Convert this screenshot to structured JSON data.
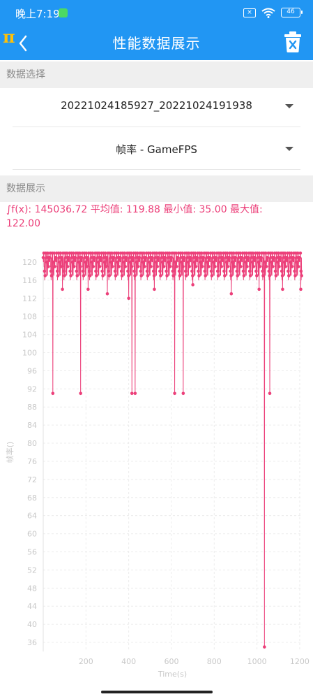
{
  "status_bar": {
    "time": "晚上7:19",
    "battery": "46"
  },
  "app_bar": {
    "title": "性能数据展示",
    "logo_text": "π"
  },
  "data_select": {
    "section_label": "数据选择",
    "file_value": "20221024185927_20221024191938",
    "metric_value": "帧率 - GameFPS"
  },
  "data_display": {
    "section_label": "数据展示",
    "summary_line1": "∫f(x): 145036.72 平均值: 119.88 最小值: 35.00 最大值:",
    "summary_line2": "122.00"
  },
  "colors": {
    "primary": "#2196f3",
    "series": "#ec407a",
    "axis_text": "#c8c8c8",
    "section_bg": "#efefef"
  },
  "chart_data": {
    "type": "line",
    "xlabel": "Time(s)",
    "ylabel": "帧率()",
    "xlim": [
      0,
      1210
    ],
    "ylim": [
      34,
      122
    ],
    "x_ticks": [
      200,
      400,
      600,
      800,
      1000,
      1200
    ],
    "y_ticks": [
      36,
      40,
      44,
      48,
      52,
      56,
      60,
      64,
      68,
      72,
      76,
      80,
      84,
      88,
      92,
      96,
      100,
      104,
      108,
      112,
      116,
      120
    ],
    "x_tick_labels": [
      "200",
      "400",
      "600",
      "800",
      "1000",
      "1200"
    ],
    "y_tick_labels": [
      "36",
      "40",
      "44",
      "48",
      "52",
      "56",
      "60",
      "64",
      "68",
      "72",
      "76",
      "80",
      "84",
      "88",
      "92",
      "96",
      "100",
      "104",
      "108",
      "112",
      "116",
      "120"
    ],
    "sample_interval_s": 1,
    "baseline_pattern": [
      121,
      119,
      122,
      120,
      118,
      121,
      117,
      120,
      122,
      119,
      121,
      116,
      120,
      118,
      122,
      121,
      119,
      117,
      121,
      120
    ],
    "dips": [
      {
        "x": 45,
        "y": 91
      },
      {
        "x": 175,
        "y": 91
      },
      {
        "x": 415,
        "y": 91
      },
      {
        "x": 430,
        "y": 91
      },
      {
        "x": 615,
        "y": 91
      },
      {
        "x": 655,
        "y": 91
      },
      {
        "x": 1035,
        "y": 35
      },
      {
        "x": 1060,
        "y": 91
      },
      {
        "x": 90,
        "y": 114
      },
      {
        "x": 210,
        "y": 114
      },
      {
        "x": 300,
        "y": 113
      },
      {
        "x": 400,
        "y": 112
      },
      {
        "x": 520,
        "y": 114
      },
      {
        "x": 700,
        "y": 115
      },
      {
        "x": 880,
        "y": 113
      },
      {
        "x": 1010,
        "y": 114
      },
      {
        "x": 1120,
        "y": 114
      },
      {
        "x": 1205,
        "y": 114
      }
    ],
    "series": [
      {
        "values_note": "",
        "color": "#ec407a"
      }
    ]
  }
}
